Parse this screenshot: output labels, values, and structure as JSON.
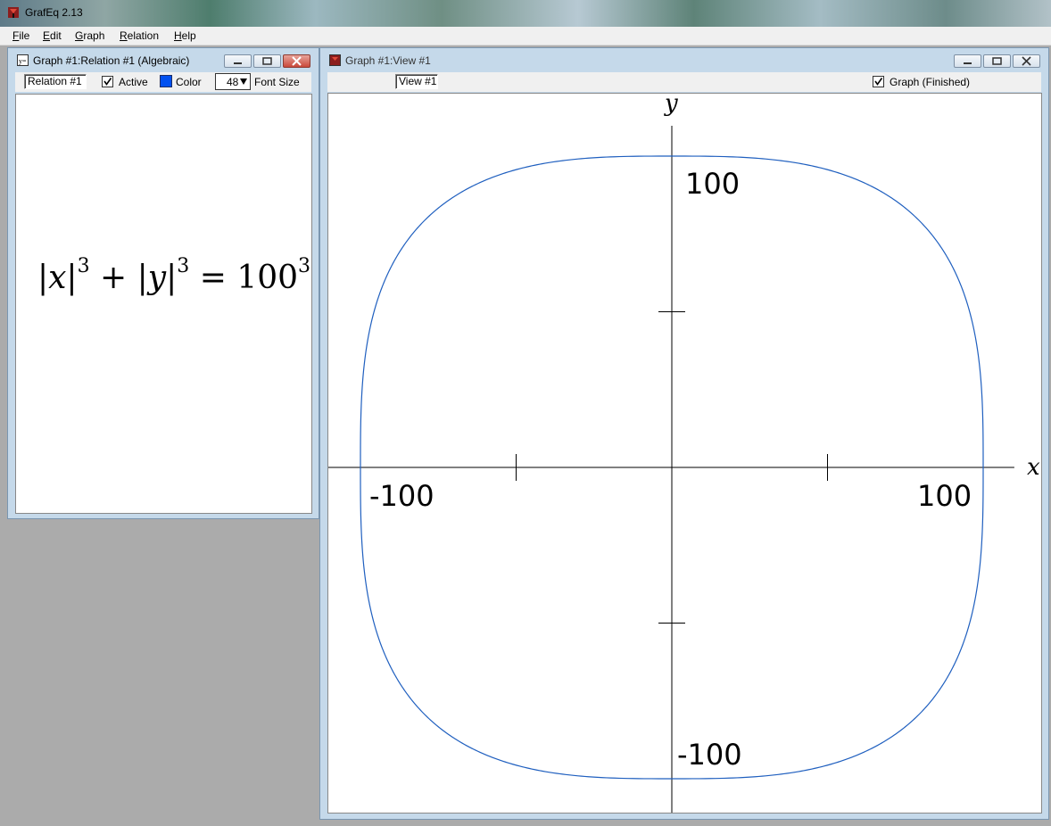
{
  "app": {
    "title": "GrafEq 2.13"
  },
  "menu": {
    "file": "File",
    "edit": "Edit",
    "graph": "Graph",
    "relation": "Relation",
    "help": "Help"
  },
  "relation_window": {
    "title": "Graph #1:Relation #1 (Algebraic)",
    "name_field": "Relation #1",
    "active_label": "Active",
    "active_checked": true,
    "color_label": "Color",
    "color": "#0050f0",
    "font_size_value": "48",
    "font_size_label": "Font Size",
    "equation": {
      "lhs1": "|x|",
      "exp1": "3",
      "plus": "+",
      "lhs2": "|y|",
      "exp2": "3",
      "equals": "=",
      "rhs": "100",
      "exp3": "3"
    }
  },
  "view_window": {
    "title": "Graph #1:View #1",
    "name_field": "View #1",
    "graph_status": "Graph (Finished)",
    "graph_checked": true
  },
  "chart_data": {
    "type": "line",
    "title": "",
    "xlabel": "x",
    "ylabel": "y",
    "xlim": [
      -110,
      110
    ],
    "ylim": [
      -100,
      100
    ],
    "relation": "|x|^3 + |y|^3 = 100^3",
    "curve_color": "#1f5fbf",
    "series": [
      {
        "name": "",
        "values": []
      }
    ],
    "x_ticks": [
      -100,
      -50,
      50,
      100
    ],
    "y_ticks": [
      -100,
      -50,
      50,
      100
    ],
    "x_tick_labels": [
      "-100",
      "100"
    ],
    "y_tick_labels": [
      "100",
      "-100"
    ],
    "grid": false
  }
}
